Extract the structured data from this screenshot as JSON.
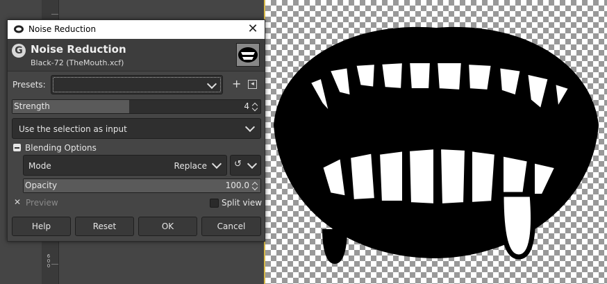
{
  "dialog": {
    "window_title": "Noise Reduction",
    "header_title": "Noise Reduction",
    "header_subtitle": "Black-72 (TheMouth.xcf)",
    "close_glyph": "✕",
    "logo_glyph": "G"
  },
  "presets": {
    "label": "Presets:",
    "value": "",
    "add_glyph": "+",
    "menu_glyph": "◂"
  },
  "strength": {
    "label": "Strength",
    "value": "4",
    "fraction": 0.47
  },
  "input_combo": {
    "value": "Use the selection as input"
  },
  "blending": {
    "label": "Blending Options",
    "mode_label": "Mode",
    "mode_value": "Replace",
    "opacity_label": "Opacity",
    "opacity_value": "100.0",
    "opacity_fraction": 1.0
  },
  "preview": {
    "label": "Preview",
    "checked_glyph": "✕",
    "split_label": "Split view"
  },
  "buttons": {
    "help": "Help",
    "reset": "Reset",
    "ok": "OK",
    "cancel": "Cancel"
  },
  "ruler": {
    "label": "6 0 0"
  },
  "colors": {
    "dialog_bg": "#454545",
    "titlebar_bg": "#ffffff",
    "canvas_frame": "#d7b94a"
  },
  "icons": [
    "gimp-logo-icon",
    "close-icon",
    "add-preset-icon",
    "preset-menu-icon",
    "chevron-down-icon",
    "mode-cycle-icon",
    "spin-arrows-icon",
    "collapse-icon"
  ]
}
